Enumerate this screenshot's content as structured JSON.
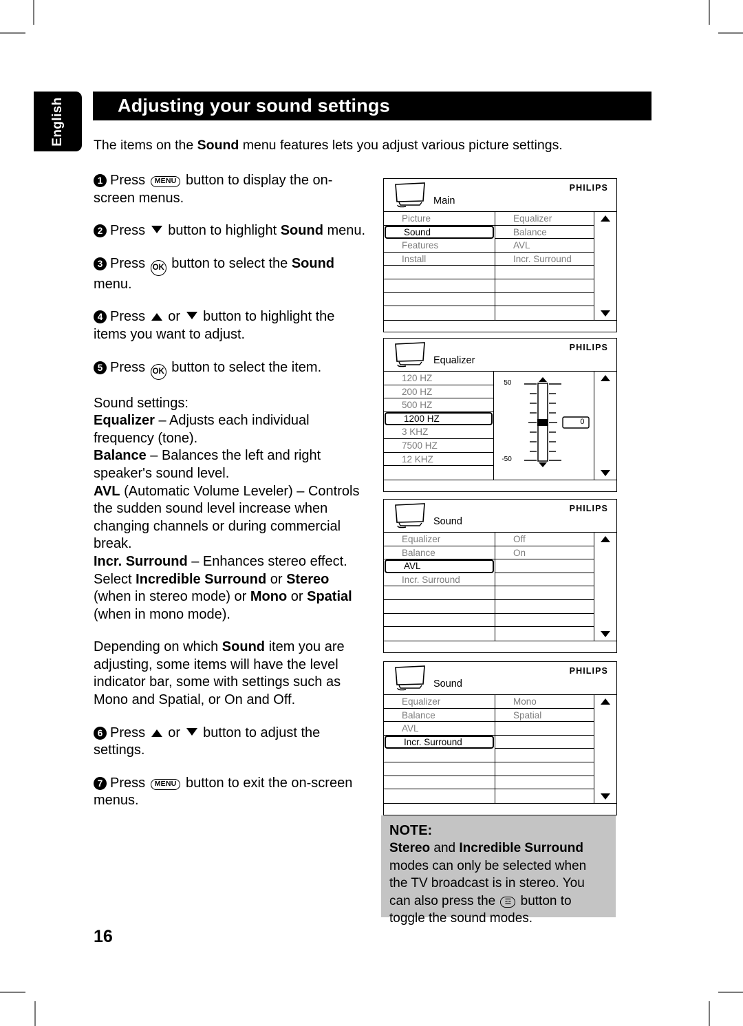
{
  "page": {
    "language_tab": "English",
    "title": "Adjusting your sound settings",
    "intro_pre": "The items on the ",
    "intro_bold": "Sound",
    "intro_post": " menu features lets you adjust various picture settings.",
    "page_number": "16"
  },
  "steps": [
    {
      "num": "1",
      "pre": "Press ",
      "button": "MENU",
      "post": " button to display the on-screen menus."
    },
    {
      "num": "2",
      "pre": "Press ",
      "arrow": "down",
      "mid": " button to highlight ",
      "bold": "Sound",
      "post": " menu."
    },
    {
      "num": "3",
      "pre": "Press ",
      "button": "OK",
      "mid": " button to select the ",
      "bold": "Sound",
      "post": " menu."
    },
    {
      "num": "4",
      "pre": "Press ",
      "arrow1": "up",
      "or": " or ",
      "arrow2": "down",
      "post": " button to highlight the items you want to adjust."
    },
    {
      "num": "5",
      "pre": "Press ",
      "button": "OK",
      "post": " button to select the item."
    },
    {
      "num": "6",
      "pre": "Press ",
      "arrow1": "up",
      "or": " or ",
      "arrow2": "down",
      "post": " button to adjust the settings."
    },
    {
      "num": "7",
      "pre": "Press ",
      "button": "MENU",
      "post": " button to exit the on-screen menus."
    }
  ],
  "sound_settings": {
    "heading": "Sound settings:",
    "items": [
      {
        "term": "Equalizer",
        "desc": " – Adjusts each individual frequency (tone)."
      },
      {
        "term": "Balance",
        "desc": " – Balances the left and right speaker's sound level."
      },
      {
        "term": "AVL",
        "desc": " (Automatic Volume Leveler) – Controls the sudden sound level increase when changing channels or during commercial break."
      },
      {
        "term": "Incr. Surround",
        "desc_a": " – Enhances stereo effect. Select ",
        "bold_a": "Incredible Surround",
        "desc_b": " or ",
        "bold_b": "Stereo",
        "desc_c": " (when in stereo mode) or ",
        "bold_c": "Mono",
        "desc_d": " or ",
        "bold_d": "Spatial",
        "desc_e": " (when in mono mode)."
      }
    ]
  },
  "depending_para": {
    "pre": "Depending on which ",
    "bold": "Sound",
    "post": " item you are adjusting, some items will have the level indicator bar, some with settings such as Mono and Spatial, or On and Off."
  },
  "osd_menus": [
    {
      "brand": "PHILIPS",
      "title": "Main",
      "left_items": [
        "Picture",
        "Sound",
        "Features",
        "Install"
      ],
      "selected_left": "Sound",
      "right_items": [
        "Equalizer",
        "Balance",
        "AVL",
        "Incr. Surround"
      ],
      "selected_right": null
    },
    {
      "brand": "PHILIPS",
      "title": "Equalizer",
      "left_items": [
        "120 HZ",
        "200 HZ",
        "500 HZ",
        "1200 HZ",
        "3 KHZ",
        "7500 HZ",
        "12 KHZ"
      ],
      "selected_left": "1200 HZ",
      "slider": {
        "max_label": "50",
        "min_label": "-50",
        "value_label": "0"
      }
    },
    {
      "brand": "PHILIPS",
      "title": "Sound",
      "left_items": [
        "Equalizer",
        "Balance",
        "AVL",
        "Incr. Surround"
      ],
      "selected_left": "AVL",
      "right_items": [
        "Off",
        "On"
      ],
      "selected_right": null
    },
    {
      "brand": "PHILIPS",
      "title": "Sound",
      "left_items": [
        "Equalizer",
        "Balance",
        "AVL",
        "Incr. Surround"
      ],
      "selected_left": "Incr. Surround",
      "right_items": [
        "Mono",
        "Spatial"
      ],
      "selected_right": null
    }
  ],
  "note": {
    "title": "NOTE:",
    "bold_a": "Stereo",
    "mid_a": " and ",
    "bold_b": "Incredible Surround",
    "text_a": " modes can only be selected when the TV broadcast is in stereo. You can also press the ",
    "button": "sound-toggle",
    "text_b": " button to toggle the sound modes."
  },
  "colors": {
    "black": "#000000",
    "note_bg": "#c4c4c4",
    "osd_dim_text": "#7c7c7c"
  }
}
